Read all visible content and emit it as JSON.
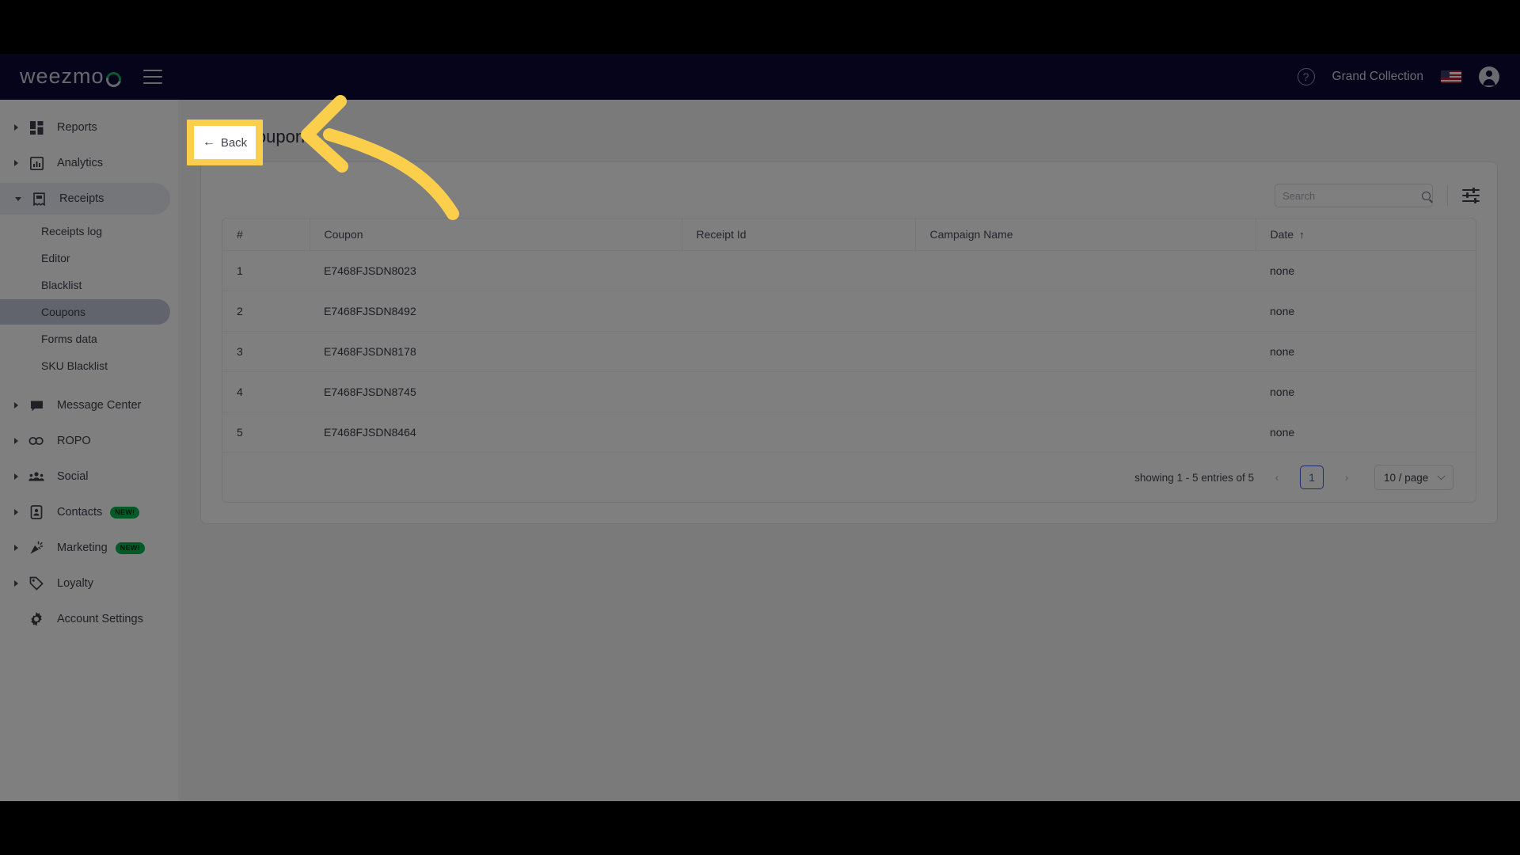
{
  "navbar": {
    "logo_text": "weezmo",
    "menu_icon": "hamburger-icon",
    "help_icon": "?",
    "account_name": "Grand Collection",
    "flag": "us-flag",
    "avatar_icon": "user-avatar-icon"
  },
  "sidebar": {
    "items": [
      {
        "label": "Reports",
        "icon": "dashboard-icon",
        "expandable": true
      },
      {
        "label": "Analytics",
        "icon": "bar-chart-icon",
        "expandable": true
      },
      {
        "label": "Receipts",
        "icon": "receipt-icon",
        "expandable": true,
        "expanded": true
      },
      {
        "label": "Message Center",
        "icon": "chat-icon",
        "expandable": true
      },
      {
        "label": "ROPO",
        "icon": "infinity-icon",
        "expandable": true
      },
      {
        "label": "Social",
        "icon": "people-icon",
        "expandable": true
      },
      {
        "label": "Contacts",
        "icon": "contact-card-icon",
        "expandable": true,
        "badge": "NEW!"
      },
      {
        "label": "Marketing",
        "icon": "party-popper-icon",
        "expandable": true,
        "badge": "NEW!"
      },
      {
        "label": "Loyalty",
        "icon": "tag-icon",
        "expandable": true
      },
      {
        "label": "Account Settings",
        "icon": "gear-icon",
        "expandable": false
      }
    ],
    "receipts_subitems": [
      {
        "label": "Receipts log",
        "selected": false
      },
      {
        "label": "Editor",
        "selected": false
      },
      {
        "label": "Blacklist",
        "selected": false
      },
      {
        "label": "Coupons",
        "selected": true
      },
      {
        "label": "Forms data",
        "selected": false
      },
      {
        "label": "SKU Blacklist",
        "selected": false
      }
    ]
  },
  "main": {
    "page_title": "Coupons",
    "search": {
      "placeholder": "Search",
      "value": ""
    },
    "filter_icon": "filter-sliders-icon",
    "table": {
      "columns": [
        "#",
        "Coupon",
        "Receipt Id",
        "Campaign Name",
        "Date"
      ],
      "sort_column": "Date",
      "sort_direction": "↑",
      "rows": [
        {
          "index": "1",
          "coupon": "E7468FJSDN8023",
          "receipt_id": "",
          "campaign_name": "",
          "date": "none"
        },
        {
          "index": "2",
          "coupon": "E7468FJSDN8492",
          "receipt_id": "",
          "campaign_name": "",
          "date": "none"
        },
        {
          "index": "3",
          "coupon": "E7468FJSDN8178",
          "receipt_id": "",
          "campaign_name": "",
          "date": "none"
        },
        {
          "index": "4",
          "coupon": "E7468FJSDN8745",
          "receipt_id": "",
          "campaign_name": "",
          "date": "none"
        },
        {
          "index": "5",
          "coupon": "E7468FJSDN8464",
          "receipt_id": "",
          "campaign_name": "",
          "date": "none"
        }
      ]
    },
    "pagination": {
      "showing": "showing 1 - 5 entries of 5",
      "prev": "‹",
      "next": "›",
      "current_page": "1",
      "per_page": "10 / page"
    }
  },
  "annotation": {
    "back_button_label": "Back",
    "back_button_arrow": "←",
    "highlight_color": "#fbcf4b",
    "arrow_color": "#fbcf4b"
  }
}
